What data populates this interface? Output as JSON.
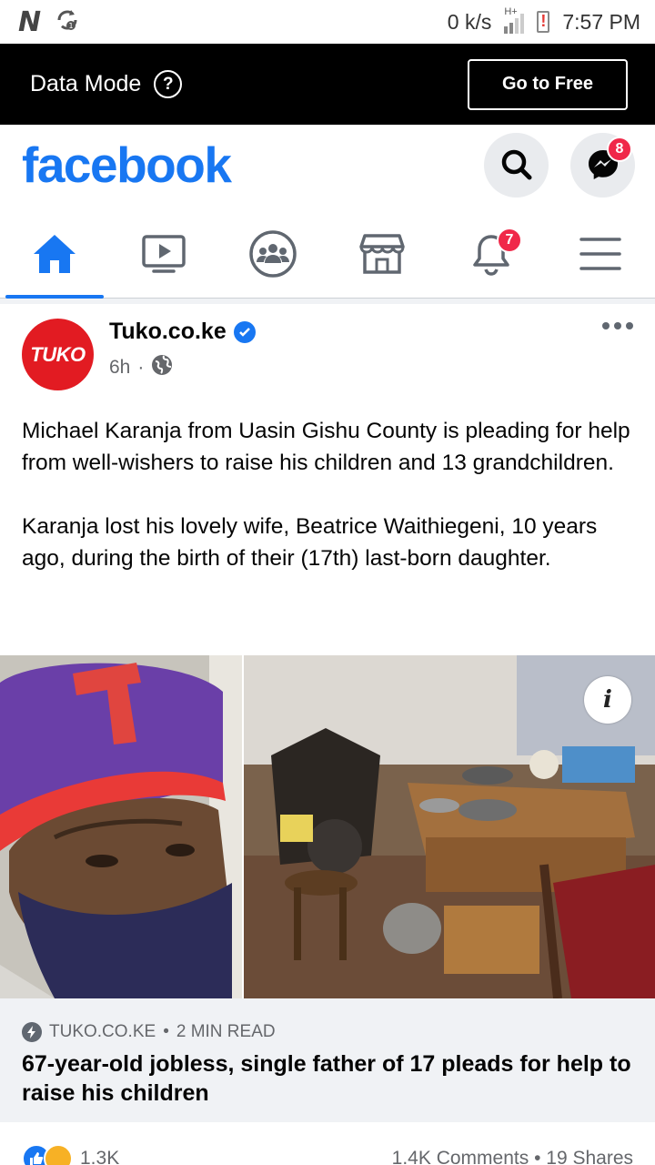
{
  "status_bar": {
    "carrier_logo": "N",
    "net_speed": "0 k/s",
    "network_type": "H+",
    "time": "7:57 PM"
  },
  "data_mode": {
    "label": "Data Mode",
    "help_symbol": "?",
    "go_free_label": "Go to Free"
  },
  "header": {
    "logo": "facebook",
    "messenger_badge": "8"
  },
  "tabs": {
    "notifications_badge": "7",
    "active": "home"
  },
  "post": {
    "author": "Tuko.co.ke",
    "avatar_text": "TUKO",
    "time": "6h",
    "paragraph1": "Michael Karanja from Uasin Gishu County is pleading for help from well-wishers to raise his children and 13 grandchildren.",
    "paragraph2": "Karanja lost his lovely wife, Beatrice Waithiegeni, 10 years ago, during the birth of their (17th) last-born daughter.",
    "info_symbol": "i",
    "link": {
      "source": "TUKO.CO.KE",
      "read_time": "2 MIN READ",
      "title": "67-year-old jobless, single father of 17 pleads for help to raise his children"
    },
    "reactions_count": "1.3K",
    "comments": "1.4K Comments",
    "shares": "19 Shares"
  },
  "colors": {
    "brand": "#1877f2",
    "badge": "#f02849",
    "tuko_red": "#e21b22"
  }
}
